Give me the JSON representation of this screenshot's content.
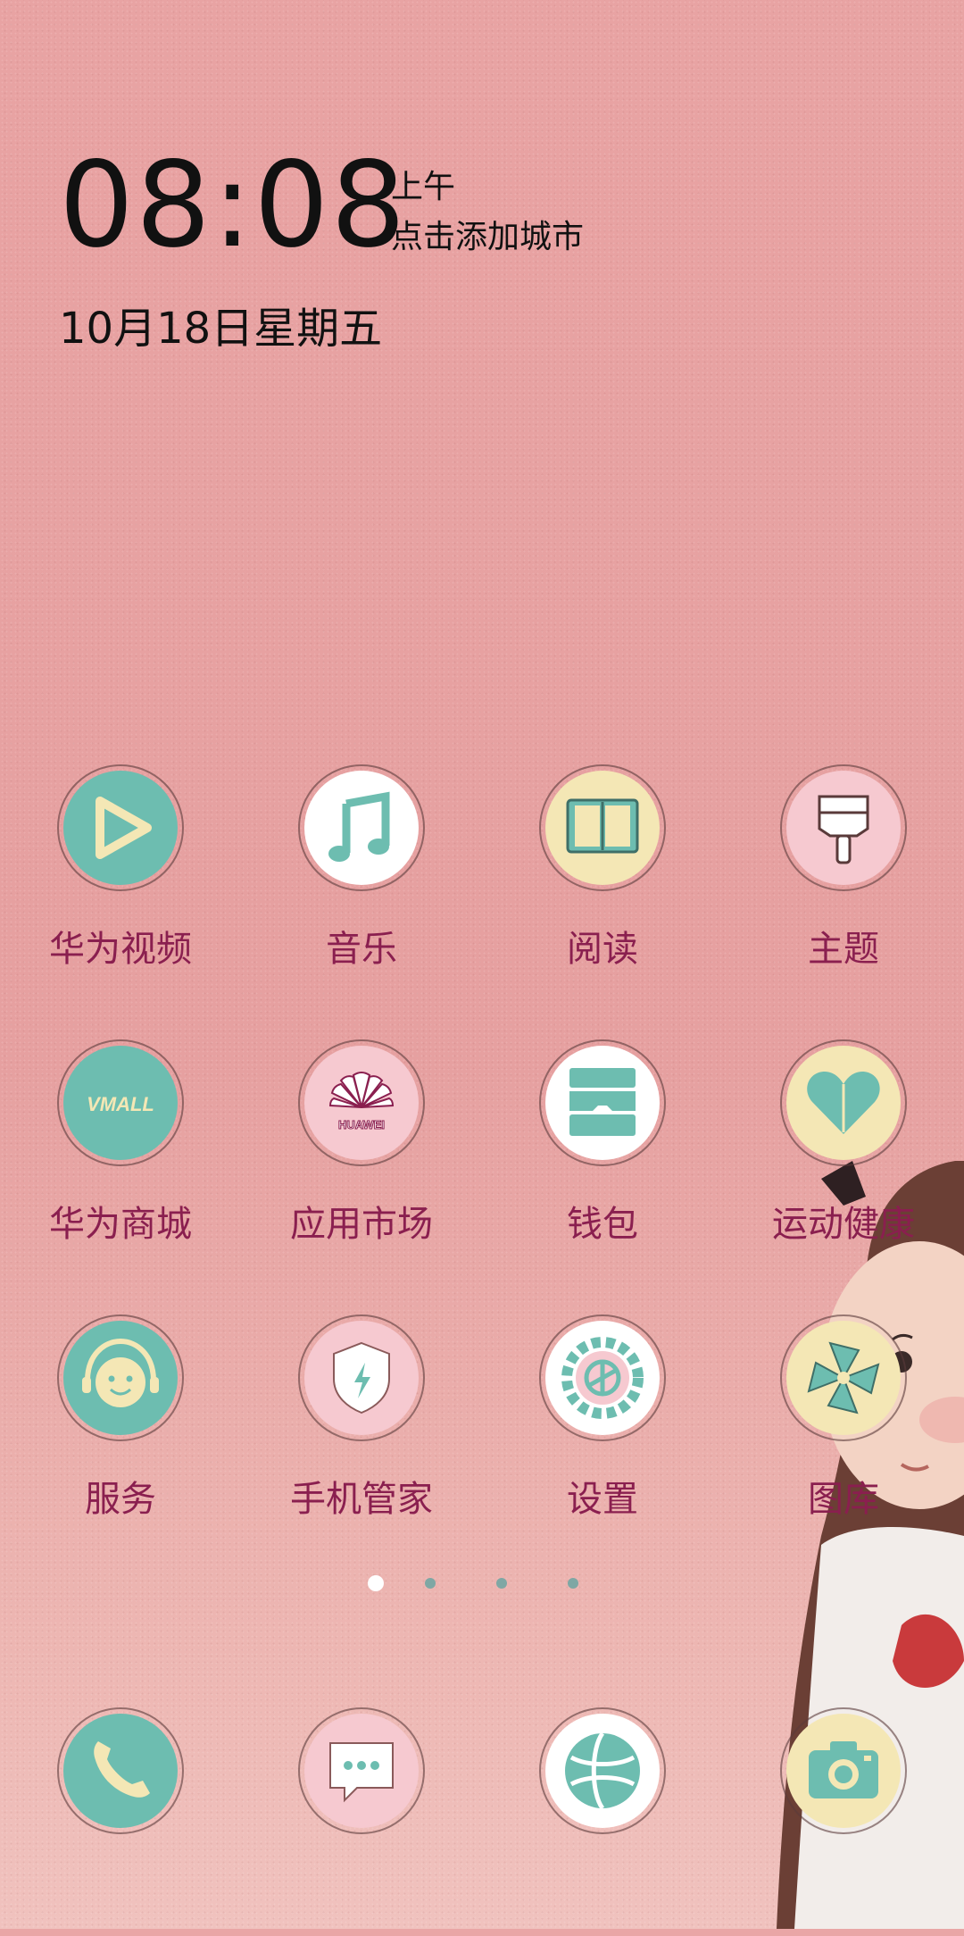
{
  "clock": {
    "time": "08:08",
    "ampm": "上午",
    "city": "点击添加城市",
    "date": "10月18日星期五"
  },
  "apps": [
    {
      "label": "华为视频",
      "icon": "video-play-icon"
    },
    {
      "label": "音乐",
      "icon": "music-note-icon"
    },
    {
      "label": "阅读",
      "icon": "book-icon"
    },
    {
      "label": "主题",
      "icon": "paintbrush-icon"
    },
    {
      "label": "华为商城",
      "icon": "vmall-icon",
      "icon_text": "VMALL"
    },
    {
      "label": "应用市场",
      "icon": "huawei-appgallery-icon",
      "icon_text": "HUAWEI"
    },
    {
      "label": "钱包",
      "icon": "wallet-icon"
    },
    {
      "label": "运动健康",
      "icon": "heart-icon"
    },
    {
      "label": "服务",
      "icon": "service-face-icon"
    },
    {
      "label": "手机管家",
      "icon": "shield-icon"
    },
    {
      "label": "设置",
      "icon": "gear-icon"
    },
    {
      "label": "图库",
      "icon": "pinwheel-flower-icon"
    }
  ],
  "page_indicator": {
    "total": 4,
    "current": 1
  },
  "dock": [
    {
      "icon": "phone-icon"
    },
    {
      "icon": "message-bubble-icon"
    },
    {
      "icon": "browser-globe-icon"
    },
    {
      "icon": "camera-icon"
    }
  ],
  "colors": {
    "wallpaper": "#E9A6A6",
    "label": "#8A1F4F",
    "teal": "#6DBDB0",
    "cream": "#F4E7B5",
    "pink": "#F6C9D0",
    "white": "#FFFFFF"
  }
}
